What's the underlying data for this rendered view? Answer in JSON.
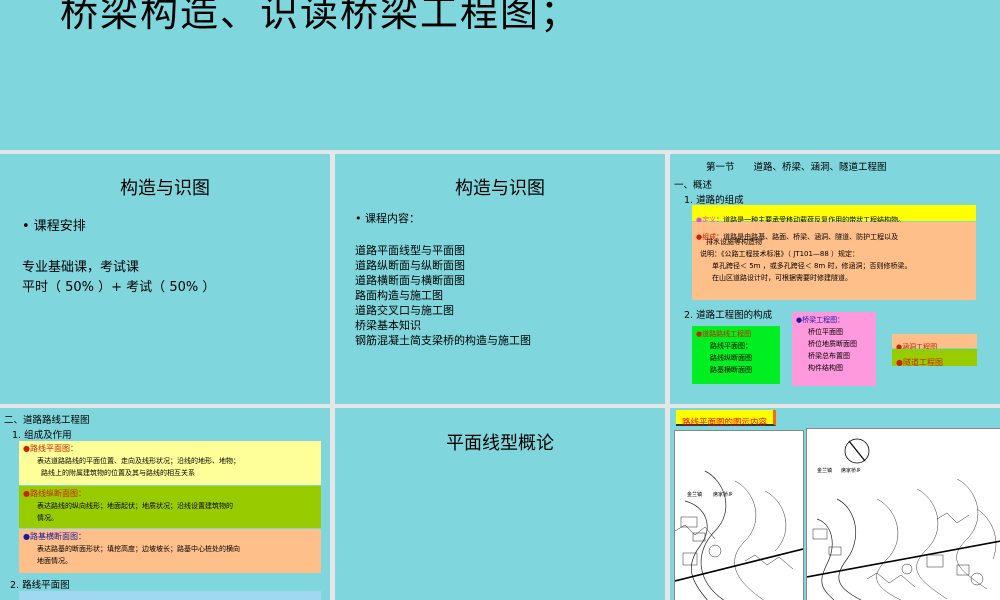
{
  "s0": {
    "title": "桥梁构造、识读桥梁工程图；"
  },
  "s1": {
    "title": "构造与识图",
    "bullet": "• 课程安排",
    "l1": "专业基础课，考试课",
    "l2": "平时（ 50% ）+ 考试（ 50% ）"
  },
  "s2": {
    "title": "构造与识图",
    "intro": "•  课程内容：",
    "items": [
      "道路平面线型与平面图",
      "道路纵断面与纵断面图",
      "道路横断面与横断面图",
      "路面构造与施工图",
      "道路交叉口与施工图",
      "桥梁基本知识",
      "钢筋混凝土简支梁桥的构造与施工图"
    ]
  },
  "s3": {
    "header": "第一节　　道路、桥梁、涵洞、隧道工程图",
    "sec": "一、概述",
    "sub1": "1. 道路的组成",
    "def_label": "●定义",
    "def_text": "：道路是一种主要承受移动载荷反复作用的带状工程结构物。",
    "comp_label": "●组成",
    "comp_text": "：道路是由路基、路面、桥梁、涵洞、隧道、防护工程以及",
    "comp_text2": "排水设施等构造物",
    "note1": "说明：《公路工程技术标准》（ JT101—88 ）规定：",
    "note2": "单孔跨径＜ 5m ，或多孔跨径＜ 8m 时，修涵洞；否则修桥梁。",
    "note3": "在山区道路设计时，可根据需要时修建隧道。",
    "sub2": "2. 道路工程图的构成",
    "road": {
      "head": "●道路路线工程图",
      "items": [
        "路线平面图；",
        "路线纵断面图",
        "路基横断面图"
      ]
    },
    "bridge": {
      "head": "●桥梁工程图：",
      "items": [
        "桥位平面图",
        "桥位地质断面图",
        "桥梁总布置图",
        "构件结构图"
      ]
    },
    "culvert": "●涵洞工程图",
    "tunnel": "●隧道工程图"
  },
  "s4": {
    "sec": "二、道路路线工程图",
    "sub1": "1. 组成及作用",
    "b1_head": "●路线平面图：",
    "b1_l1": "表达道路路线的平面位置、走向及线形状况；沿线的地形、地物；",
    "b1_l2": "路线上的附属建筑物的位置及其与路线的相互关系",
    "b2_head": "●路线纵断面图：",
    "b2_l1": "表达路线的纵向线形；地面起伏；地质状况；沿线设置建筑物的",
    "b2_l2": "情况。",
    "b3_head": "●路基横断面图：",
    "b3_l1": "表达路基的断面形状；填挖高度；边坡坡长；路基中心桩处的横向",
    "b3_l2": "地面情况。",
    "sub2": "2. 路线平面图"
  },
  "s5": {
    "title": "平面线型概论"
  },
  "s6": {
    "label": "路线平面图的图示内容",
    "map_text1": "金兰镇",
    "map_text2": "席家桥乡",
    "map_text3": "金兰镇",
    "map_text4": "席家桥乡"
  },
  "colors": {
    "slide_bg": "#7fd6dc",
    "yellow": "#ffff00",
    "peach": "#ffbf8a",
    "green": "#00ee22",
    "pink": "#ff99dd",
    "olive": "#99cc00",
    "light_yellow": "#ffff99"
  }
}
